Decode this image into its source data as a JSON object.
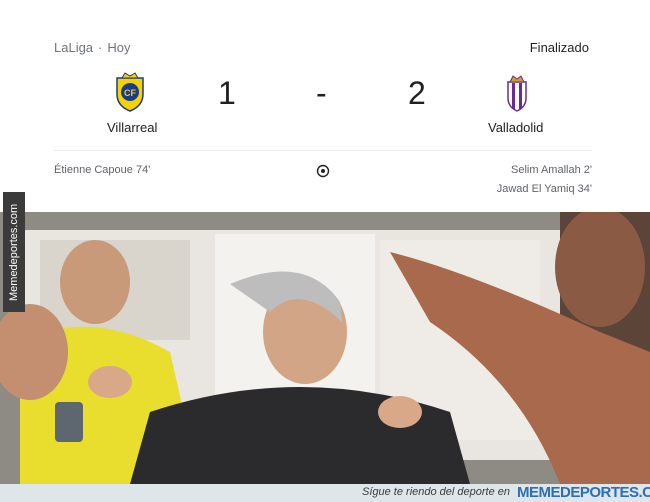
{
  "match": {
    "competition": "LaLiga",
    "date": "Hoy",
    "status": "Finalizado",
    "home": {
      "name": "Villarreal",
      "score": "1",
      "crest": "villarreal-crest"
    },
    "away": {
      "name": "Valladolid",
      "score": "2",
      "crest": "valladolid-crest"
    },
    "dash": "-",
    "home_scorers": [
      "Étienne Capoue 74'"
    ],
    "away_scorers": [
      "Selim Amallah 2'",
      "Jawad El Yamiq 34'"
    ],
    "goal_icon": "soccer-ball-icon"
  },
  "watermark": "Memedeportes.com",
  "footer": {
    "tagline": "Sígue te riendo del deporte en",
    "brand": "MEMEDEPORTES.COM"
  },
  "colors": {
    "villarreal": "#f6d200",
    "valladolid": "#6a2c8f",
    "brand": "#2b6fb8"
  }
}
